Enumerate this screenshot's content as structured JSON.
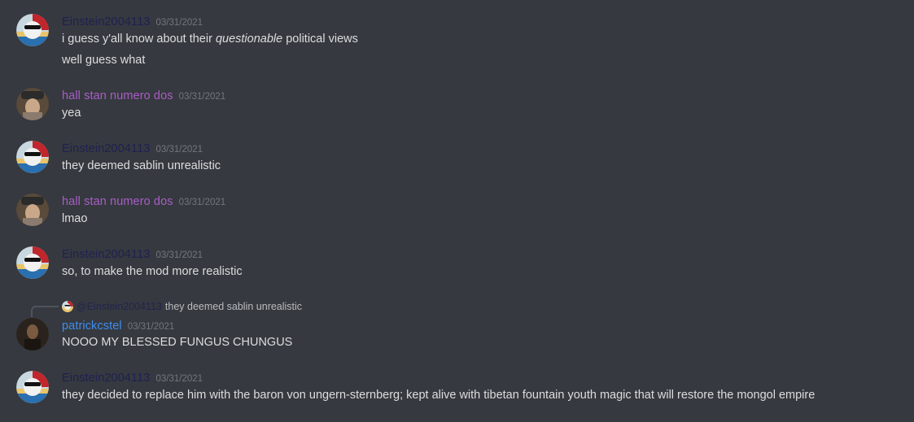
{
  "messages": [
    {
      "username": "Einstein2004113",
      "username_color": "#1e2150",
      "timestamp": "03/31/2021",
      "avatar": "ball-flag-avatar",
      "lines": [
        {
          "before": "i guess y'all know about their ",
          "em": "questionable",
          "after": " political views"
        },
        {
          "before": "well guess what",
          "em": "",
          "after": ""
        }
      ]
    },
    {
      "username": "hall stan numero dos",
      "username_color": "#a95dc9",
      "timestamp": "03/31/2021",
      "avatar": "photo-avatar",
      "lines": [
        {
          "before": "yea",
          "em": "",
          "after": ""
        }
      ]
    },
    {
      "username": "Einstein2004113",
      "username_color": "#1e2150",
      "timestamp": "03/31/2021",
      "avatar": "ball-flag-avatar",
      "lines": [
        {
          "before": "they deemed sablin unrealistic",
          "em": "",
          "after": ""
        }
      ]
    },
    {
      "username": "hall stan numero dos",
      "username_color": "#a95dc9",
      "timestamp": "03/31/2021",
      "avatar": "photo-avatar",
      "lines": [
        {
          "before": "lmao",
          "em": "",
          "after": ""
        }
      ]
    },
    {
      "username": "Einstein2004113",
      "username_color": "#1e2150",
      "timestamp": "03/31/2021",
      "avatar": "ball-flag-avatar",
      "lines": [
        {
          "before": "so, to make the mod more realistic",
          "em": "",
          "after": ""
        }
      ]
    },
    {
      "username": "patrickcstel",
      "username_color": "#3e8ef0",
      "timestamp": "03/31/2021",
      "avatar": "dark-photo-avatar",
      "reply": {
        "name": "@Einstein2004113",
        "text": "they deemed sablin unrealistic"
      },
      "lines": [
        {
          "before": "NOOO MY BLESSED FUNGUS CHUNGUS",
          "em": "",
          "after": ""
        }
      ]
    },
    {
      "username": "Einstein2004113",
      "username_color": "#1e2150",
      "timestamp": "03/31/2021",
      "avatar": "ball-flag-avatar",
      "lines": [
        {
          "before": "they decided to replace him with the baron von ungern-sternberg; kept alive with tibetan fountain youth magic that will restore the mongol empire",
          "em": "",
          "after": ""
        }
      ]
    }
  ]
}
